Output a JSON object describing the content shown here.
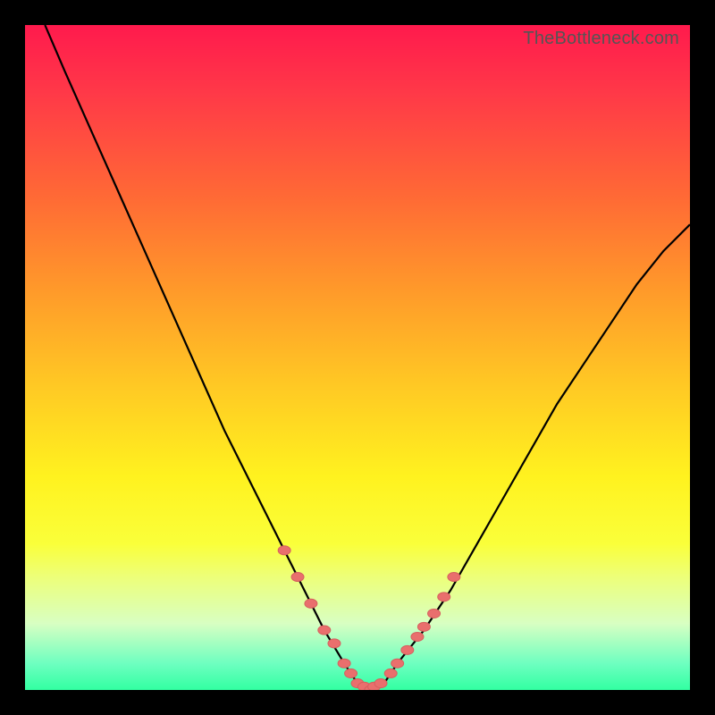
{
  "watermark": "TheBottleneck.com",
  "colors": {
    "curve_stroke": "#000000",
    "marker_fill": "#e96f6d",
    "marker_stroke": "#d6605e",
    "frame": "#000000"
  },
  "chart_data": {
    "type": "line",
    "title": "",
    "xlabel": "",
    "ylabel": "",
    "xlim": [
      0,
      100
    ],
    "ylim": [
      0,
      100
    ],
    "series": [
      {
        "name": "bottleneck-curve",
        "x": [
          3,
          6,
          10,
          14,
          18,
          22,
          26,
          30,
          34,
          38,
          42,
          45,
          48,
          50,
          52,
          54,
          56,
          60,
          64,
          68,
          72,
          76,
          80,
          84,
          88,
          92,
          96,
          100
        ],
        "y": [
          100,
          93,
          84,
          75,
          66,
          57,
          48,
          39,
          31,
          23,
          15,
          9,
          4,
          1,
          0,
          1,
          4,
          9,
          15,
          22,
          29,
          36,
          43,
          49,
          55,
          61,
          66,
          70
        ]
      }
    ],
    "markers": {
      "name": "highlighted-points",
      "x": [
        39,
        41,
        43,
        45,
        46.5,
        48,
        49,
        50,
        51,
        52,
        52.5,
        53.5,
        55,
        56,
        57.5,
        59,
        60,
        61.5,
        63,
        64.5
      ],
      "y": [
        21,
        17,
        13,
        9,
        7,
        4,
        2.5,
        1,
        0.5,
        0,
        0.5,
        1,
        2.5,
        4,
        6,
        8,
        9.5,
        11.5,
        14,
        17
      ]
    }
  }
}
